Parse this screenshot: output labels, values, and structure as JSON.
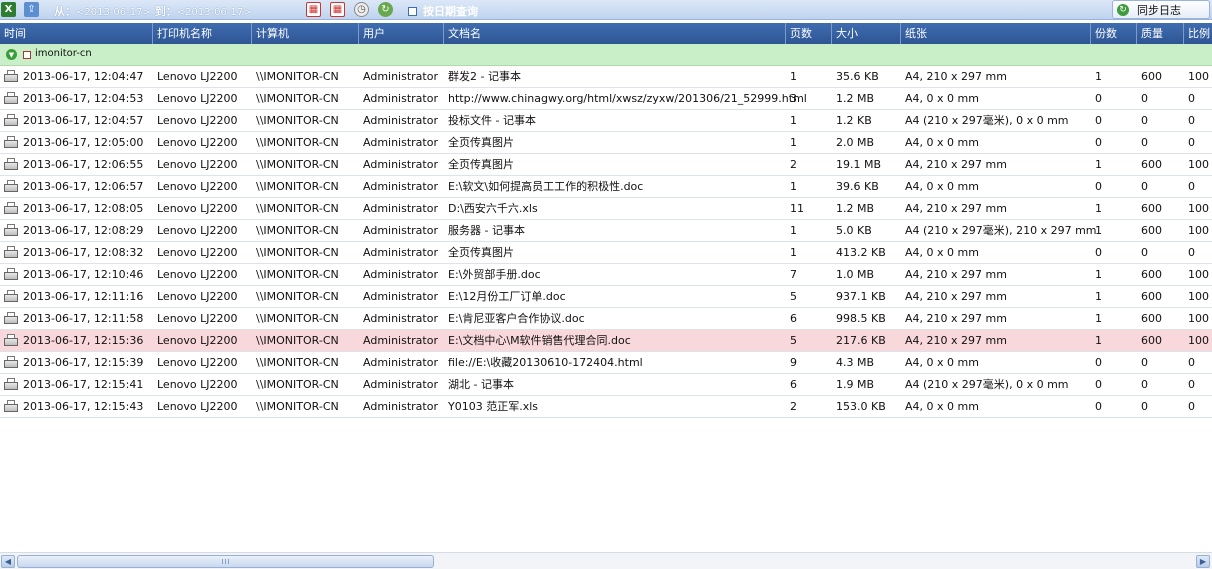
{
  "toolbar": {
    "from_label": "从：",
    "from_date": "<2013-06-17>",
    "to_label": "到：",
    "to_date": "<2013-06-17>",
    "date_query_label": "按日期查询",
    "sync_label": "同步日志",
    "icons": [
      "excel-export-icon",
      "export-icon",
      "calendar-from-icon",
      "calendar-to-icon",
      "clock-icon",
      "refresh-icon"
    ]
  },
  "columns": [
    "时间",
    "打印机名称",
    "计算机",
    "用户",
    "文档名",
    "页数",
    "大小",
    "纸张",
    "份数",
    "质量",
    "比例"
  ],
  "group": {
    "label": "imonitor-cn"
  },
  "rows": [
    {
      "time": "2013-06-17, 12:04:47",
      "printer": "Lenovo LJ2200",
      "computer": "\\\\IMONITOR-CN",
      "user": "Administrator",
      "doc": "群发2 - 记事本",
      "pages": "1",
      "size": "35.6 KB",
      "paper": "A4, 210 x 297 mm",
      "copies": "1",
      "quality": "600",
      "scale": "100"
    },
    {
      "time": "2013-06-17, 12:04:53",
      "printer": "Lenovo LJ2200",
      "computer": "\\\\IMONITOR-CN",
      "user": "Administrator",
      "doc": "http://www.chinagwy.org/html/xwsz/zyxw/201306/21_52999.html",
      "pages": "3",
      "size": "1.2 MB",
      "paper": "A4, 0 x 0 mm",
      "copies": "0",
      "quality": "0",
      "scale": "0"
    },
    {
      "time": "2013-06-17, 12:04:57",
      "printer": "Lenovo LJ2200",
      "computer": "\\\\IMONITOR-CN",
      "user": "Administrator",
      "doc": "投标文件 - 记事本",
      "pages": "1",
      "size": "1.2 KB",
      "paper": "A4 (210 x 297毫米), 0 x 0 mm",
      "copies": "0",
      "quality": "0",
      "scale": "0"
    },
    {
      "time": "2013-06-17, 12:05:00",
      "printer": "Lenovo LJ2200",
      "computer": "\\\\IMONITOR-CN",
      "user": "Administrator",
      "doc": "全页传真图片",
      "pages": "1",
      "size": "2.0 MB",
      "paper": "A4, 0 x 0 mm",
      "copies": "0",
      "quality": "0",
      "scale": "0"
    },
    {
      "time": "2013-06-17, 12:06:55",
      "printer": "Lenovo LJ2200",
      "computer": "\\\\IMONITOR-CN",
      "user": "Administrator",
      "doc": "全页传真图片",
      "pages": "2",
      "size": "19.1 MB",
      "paper": "A4, 210 x 297 mm",
      "copies": "1",
      "quality": "600",
      "scale": "100"
    },
    {
      "time": "2013-06-17, 12:06:57",
      "printer": "Lenovo LJ2200",
      "computer": "\\\\IMONITOR-CN",
      "user": "Administrator",
      "doc": "E:\\软文\\如何提高员工工作的积极性.doc",
      "pages": "1",
      "size": "39.6 KB",
      "paper": "A4, 0 x 0 mm",
      "copies": "0",
      "quality": "0",
      "scale": "0"
    },
    {
      "time": "2013-06-17, 12:08:05",
      "printer": "Lenovo LJ2200",
      "computer": "\\\\IMONITOR-CN",
      "user": "Administrator",
      "doc": "D:\\西安六千六.xls",
      "pages": "11",
      "size": "1.2 MB",
      "paper": "A4, 210 x 297 mm",
      "copies": "1",
      "quality": "600",
      "scale": "100"
    },
    {
      "time": "2013-06-17, 12:08:29",
      "printer": "Lenovo LJ2200",
      "computer": "\\\\IMONITOR-CN",
      "user": "Administrator",
      "doc": "服务器 - 记事本",
      "pages": "1",
      "size": "5.0 KB",
      "paper": "A4 (210 x 297毫米), 210 x 297 mm",
      "copies": "1",
      "quality": "600",
      "scale": "100"
    },
    {
      "time": "2013-06-17, 12:08:32",
      "printer": "Lenovo LJ2200",
      "computer": "\\\\IMONITOR-CN",
      "user": "Administrator",
      "doc": "全页传真图片",
      "pages": "1",
      "size": "413.2 KB",
      "paper": "A4, 0 x 0 mm",
      "copies": "0",
      "quality": "0",
      "scale": "0"
    },
    {
      "time": "2013-06-17, 12:10:46",
      "printer": "Lenovo LJ2200",
      "computer": "\\\\IMONITOR-CN",
      "user": "Administrator",
      "doc": "E:\\外贸部手册.doc",
      "pages": "7",
      "size": "1.0 MB",
      "paper": "A4, 210 x 297 mm",
      "copies": "1",
      "quality": "600",
      "scale": "100"
    },
    {
      "time": "2013-06-17, 12:11:16",
      "printer": "Lenovo LJ2200",
      "computer": "\\\\IMONITOR-CN",
      "user": "Administrator",
      "doc": "E:\\12月份工厂订单.doc",
      "pages": "5",
      "size": "937.1 KB",
      "paper": "A4, 210 x 297 mm",
      "copies": "1",
      "quality": "600",
      "scale": "100"
    },
    {
      "time": "2013-06-17, 12:11:58",
      "printer": "Lenovo LJ2200",
      "computer": "\\\\IMONITOR-CN",
      "user": "Administrator",
      "doc": "E:\\肯尼亚客户合作协议.doc",
      "pages": "6",
      "size": "998.5 KB",
      "paper": "A4, 210 x 297 mm",
      "copies": "1",
      "quality": "600",
      "scale": "100"
    },
    {
      "time": "2013-06-17, 12:15:36",
      "printer": "Lenovo LJ2200",
      "computer": "\\\\IMONITOR-CN",
      "user": "Administrator",
      "doc": "E:\\文档中心\\M软件销售代理合同.doc",
      "pages": "5",
      "size": "217.6 KB",
      "paper": "A4, 210 x 297 mm",
      "copies": "1",
      "quality": "600",
      "scale": "100",
      "selected": true
    },
    {
      "time": "2013-06-17, 12:15:39",
      "printer": "Lenovo LJ2200",
      "computer": "\\\\IMONITOR-CN",
      "user": "Administrator",
      "doc": "file://E:\\收藏20130610-172404.html",
      "pages": "9",
      "size": "4.3 MB",
      "paper": "A4, 0 x 0 mm",
      "copies": "0",
      "quality": "0",
      "scale": "0"
    },
    {
      "time": "2013-06-17, 12:15:41",
      "printer": "Lenovo LJ2200",
      "computer": "\\\\IMONITOR-CN",
      "user": "Administrator",
      "doc": "湖北 - 记事本",
      "pages": "6",
      "size": "1.9 MB",
      "paper": "A4 (210 x 297毫米), 0 x 0 mm",
      "copies": "0",
      "quality": "0",
      "scale": "0"
    },
    {
      "time": "2013-06-17, 12:15:43",
      "printer": "Lenovo LJ2200",
      "computer": "\\\\IMONITOR-CN",
      "user": "Administrator",
      "doc": "Y0103 范正军.xls",
      "pages": "2",
      "size": "153.0 KB",
      "paper": "A4, 0 x 0 mm",
      "copies": "0",
      "quality": "0",
      "scale": "0"
    }
  ],
  "colors": {
    "header": "#2e5594",
    "group": "#c9efc9",
    "selected_row": "#f9d8dc",
    "toolbar": "#bfd3ee"
  }
}
